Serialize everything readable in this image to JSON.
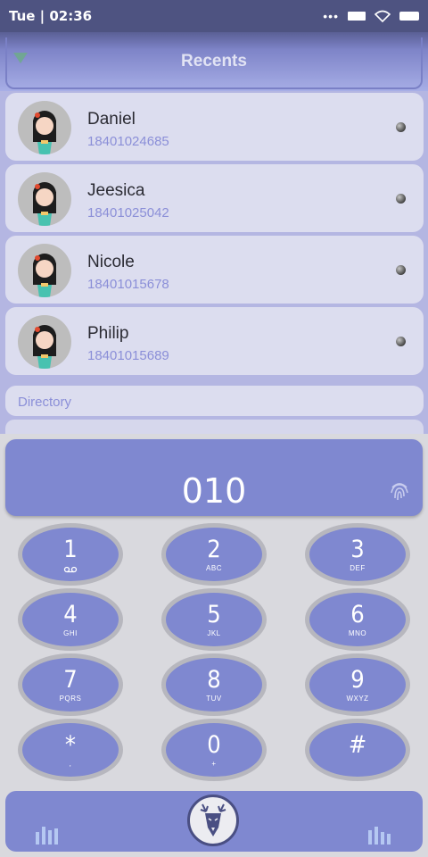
{
  "status_bar": {
    "time": "Tue | 02:36"
  },
  "header": {
    "title": "Recents"
  },
  "recents": [
    {
      "name": "Daniel",
      "number": "18401024685"
    },
    {
      "name": "Jeesica",
      "number": "18401025042"
    },
    {
      "name": "Nicole",
      "number": "18401015678"
    },
    {
      "name": "Philip",
      "number": "18401015689"
    }
  ],
  "directory": {
    "label": "Directory"
  },
  "dialer": {
    "input_value": "010",
    "keys": [
      {
        "digit": "1",
        "letters": ""
      },
      {
        "digit": "2",
        "letters": "ABC"
      },
      {
        "digit": "3",
        "letters": "DEF"
      },
      {
        "digit": "4",
        "letters": "GHI"
      },
      {
        "digit": "5",
        "letters": "JKL"
      },
      {
        "digit": "6",
        "letters": "MNO"
      },
      {
        "digit": "7",
        "letters": "PQRS"
      },
      {
        "digit": "8",
        "letters": "TUV"
      },
      {
        "digit": "9",
        "letters": "WXYZ"
      },
      {
        "digit": "*",
        "letters": ","
      },
      {
        "digit": "0",
        "letters": "+"
      },
      {
        "digit": "#",
        "letters": ""
      }
    ]
  },
  "colors": {
    "accent": "#7f88d0",
    "number_text": "#8b8fd8",
    "status_bar": "#4e5381"
  },
  "icons": {
    "voicemail": "voicemail-icon",
    "fingerprint": "fingerprint-icon",
    "equalizer": "equalizer-icon",
    "call": "deer-logo-icon",
    "call_status": "call-status-dot-icon"
  }
}
